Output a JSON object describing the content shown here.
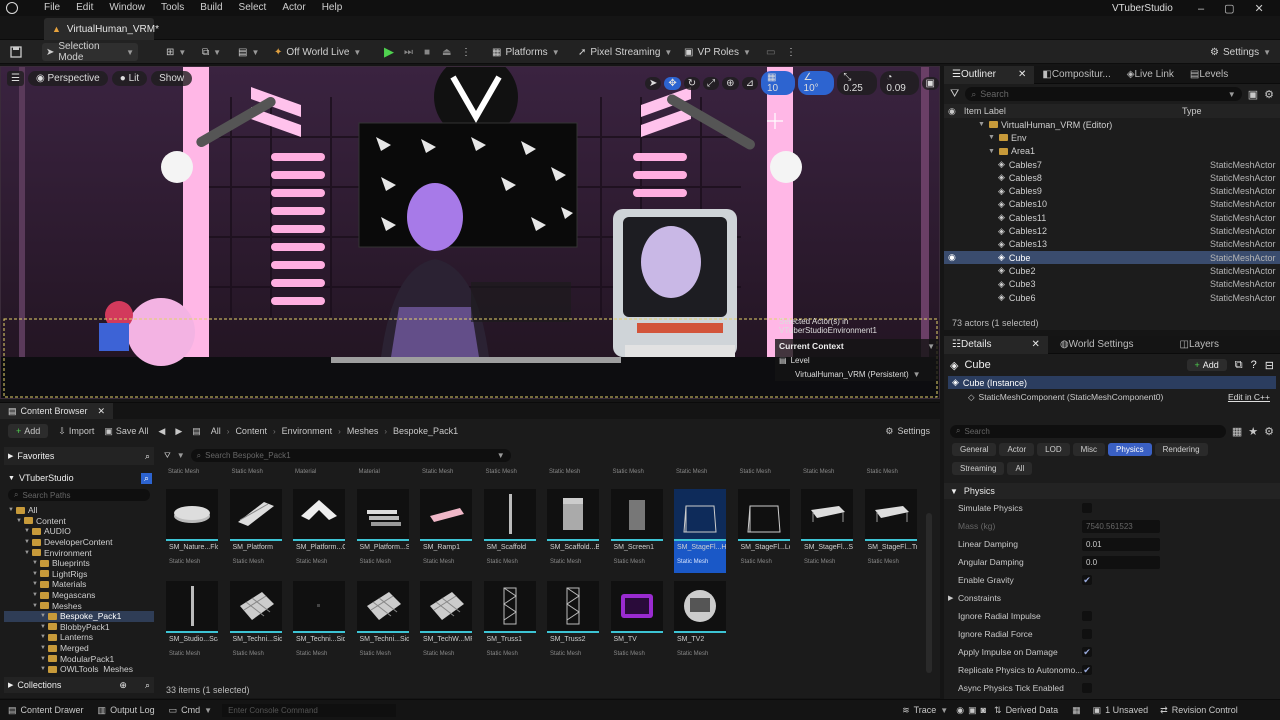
{
  "app": {
    "title": "VTuberStudio",
    "menu": [
      "File",
      "Edit",
      "Window",
      "Tools",
      "Build",
      "Select",
      "Actor",
      "Help"
    ],
    "tab": "VirtualHuman_VRM*"
  },
  "toolbar": {
    "selection_mode": "Selection Mode",
    "world": "Off World Live",
    "platforms": "Platforms",
    "pixel_streaming": "Pixel Streaming",
    "vp_roles": "VP Roles",
    "settings": "Settings"
  },
  "viewport": {
    "perspective": "Perspective",
    "lit": "Lit",
    "show": "Show",
    "grid_snap": "10",
    "rot_snap": "10°",
    "scale_snap": "0.25",
    "cam_speed": "0.09",
    "context": {
      "selected_line1": "Selected Actor(s) in",
      "selected_line2": "VTuberStudioEnvironment1",
      "current_context": "Current Context",
      "level_label": "Level",
      "level_value": "VirtualHuman_VRM (Persistent)"
    },
    "colors": {
      "accent": "#ff9fd8",
      "backdrop": "#2b1a2e"
    }
  },
  "outliner": {
    "tabs": [
      "Outliner",
      "Compositur...",
      "Live Link",
      "Levels"
    ],
    "search_placeholder": "Search",
    "col_label": "Item Label",
    "col_type": "Type",
    "tree": [
      {
        "label": "VirtualHuman_VRM (Editor)",
        "type": ""
      },
      {
        "label": "Env",
        "type": ""
      },
      {
        "label": "Area1",
        "type": ""
      }
    ],
    "rows": [
      {
        "label": "Cables7",
        "type": "StaticMeshActor"
      },
      {
        "label": "Cables8",
        "type": "StaticMeshActor"
      },
      {
        "label": "Cables9",
        "type": "StaticMeshActor"
      },
      {
        "label": "Cables10",
        "type": "StaticMeshActor"
      },
      {
        "label": "Cables11",
        "type": "StaticMeshActor"
      },
      {
        "label": "Cables12",
        "type": "StaticMeshActor"
      },
      {
        "label": "Cables13",
        "type": "StaticMeshActor"
      },
      {
        "label": "Cube",
        "type": "StaticMeshActor"
      },
      {
        "label": "Cube2",
        "type": "StaticMeshActor"
      },
      {
        "label": "Cube3",
        "type": "StaticMeshActor"
      },
      {
        "label": "Cube6",
        "type": "StaticMeshActor"
      }
    ],
    "footer": "73 actors (1 selected)"
  },
  "details": {
    "tabs": [
      "Details",
      "World Settings",
      "Layers"
    ],
    "object": "Cube",
    "add": "Add",
    "instance": "Cube (Instance)",
    "component": "StaticMeshComponent (StaticMeshComponent0)",
    "edit_cpp": "Edit in C++",
    "search_placeholder": "Search",
    "filters": [
      "General",
      "Actor",
      "LOD",
      "Misc",
      "Physics",
      "Rendering",
      "Streaming",
      "All"
    ],
    "section": "Physics",
    "props": [
      {
        "label": "Simulate Physics",
        "kind": "check",
        "value": ""
      },
      {
        "label": "Mass (kg)",
        "kind": "value",
        "value": "7540.561523"
      },
      {
        "label": "Linear Damping",
        "kind": "value",
        "value": "0.01"
      },
      {
        "label": "Angular Damping",
        "kind": "value",
        "value": "0.0"
      },
      {
        "label": "Enable Gravity",
        "kind": "check",
        "value": "✔"
      },
      {
        "label": "Constraints",
        "kind": "section",
        "value": ""
      },
      {
        "label": "Ignore Radial Impulse",
        "kind": "check",
        "value": ""
      },
      {
        "label": "Ignore Radial Force",
        "kind": "check",
        "value": ""
      },
      {
        "label": "Apply Impulse on Damage",
        "kind": "check",
        "value": "✔"
      },
      {
        "label": "Replicate Physics to Autonomo...",
        "kind": "check",
        "value": "✔"
      },
      {
        "label": "Async Physics Tick Enabled",
        "kind": "check",
        "value": ""
      }
    ]
  },
  "content_browser": {
    "title": "Content Browser",
    "add": "Add",
    "import": "Import",
    "save_all": "Save All",
    "settings": "Settings",
    "breadcrumb": [
      "All",
      "Content",
      "Environment",
      "Meshes",
      "Bespoke_Pack1"
    ],
    "search_placeholder": "Search Bespoke_Pack1",
    "favorites": "Favorites",
    "project": "VTuberStudio",
    "search_paths": "Search Paths",
    "tree": [
      {
        "label": "All",
        "indent": 0
      },
      {
        "label": "Content",
        "indent": 1
      },
      {
        "label": "AUDIO",
        "indent": 2
      },
      {
        "label": "DeveloperContent",
        "indent": 2
      },
      {
        "label": "Environment",
        "indent": 2
      },
      {
        "label": "Blueprints",
        "indent": 3
      },
      {
        "label": "LightRigs",
        "indent": 3
      },
      {
        "label": "Materials",
        "indent": 3
      },
      {
        "label": "Megascans",
        "indent": 3
      },
      {
        "label": "Meshes",
        "indent": 3
      },
      {
        "label": "Bespoke_Pack1",
        "indent": 4
      },
      {
        "label": "BlobbyPack1",
        "indent": 4
      },
      {
        "label": "Lanterns",
        "indent": 4
      },
      {
        "label": "Merged",
        "indent": 4
      },
      {
        "label": "ModularPack1",
        "indent": 4
      },
      {
        "label": "OWLTools_Meshes",
        "indent": 4
      }
    ],
    "collections": "Collections",
    "top_types": [
      "Static Mesh",
      "Static Mesh",
      "Material",
      "Material",
      "Static Mesh",
      "Static Mesh",
      "Static Mesh",
      "Static Mesh",
      "Static Mesh",
      "Static Mesh",
      "Static Mesh",
      "Static Mesh"
    ],
    "assets": [
      {
        "name": "SM_Nature...Floor",
        "type": "Static Mesh",
        "icon": "disc-icon"
      },
      {
        "name": "SM_Platform",
        "type": "Static Mesh",
        "icon": "platform-icon"
      },
      {
        "name": "SM_Platform...Corner",
        "type": "Static Mesh",
        "icon": "corner-icon"
      },
      {
        "name": "SM_Platform...Stairs",
        "type": "Static Mesh",
        "icon": "stairs-icon"
      },
      {
        "name": "SM_Ramp1",
        "type": "Static Mesh",
        "icon": "ramp-icon"
      },
      {
        "name": "SM_Scaffold",
        "type": "Static Mesh",
        "icon": "pole-icon"
      },
      {
        "name": "SM_Scaffold...Base",
        "type": "Static Mesh",
        "icon": "box-icon"
      },
      {
        "name": "SM_Screen1",
        "type": "Static Mesh",
        "icon": "panel-icon"
      },
      {
        "name": "SM_StageFl...Hexagon",
        "type": "Static Mesh",
        "icon": "stage-icon"
      },
      {
        "name": "SM_StageFl...Long",
        "type": "Static Mesh",
        "icon": "stage-icon"
      },
      {
        "name": "SM_StageFl...Single",
        "type": "Static Mesh",
        "icon": "table-icon"
      },
      {
        "name": "SM_StageFl...Triple",
        "type": "Static Mesh",
        "icon": "table-icon"
      },
      {
        "name": "SM_Studio...Scaffold",
        "type": "Static Mesh",
        "icon": "pole-icon"
      },
      {
        "name": "SM_Techni...Sides",
        "type": "Static Mesh",
        "icon": "grid-icon"
      },
      {
        "name": "SM_Techni...SidesFloor",
        "type": "Static Mesh",
        "icon": "dark-icon"
      },
      {
        "name": "SM_Techni...SidesWall",
        "type": "Static Mesh",
        "icon": "grid-icon"
      },
      {
        "name": "SM_TechW...MRGD",
        "type": "Static Mesh",
        "icon": "grid-icon"
      },
      {
        "name": "SM_Truss1",
        "type": "Static Mesh",
        "icon": "truss-icon"
      },
      {
        "name": "SM_Truss2",
        "type": "Static Mesh",
        "icon": "truss-icon"
      },
      {
        "name": "SM_TV",
        "type": "Static Mesh",
        "icon": "tv-icon"
      },
      {
        "name": "SM_TV2",
        "type": "Static Mesh",
        "icon": "tv2-icon"
      }
    ],
    "footer": "33 items (1 selected)"
  },
  "status_bar": {
    "content_drawer": "Content Drawer",
    "output_log": "Output Log",
    "cmd": "Cmd",
    "console_placeholder": "Enter Console Command",
    "trace": "Trace",
    "derived_data": "Derived Data",
    "unsaved": "1 Unsaved",
    "revision_control": "Revision Control"
  }
}
